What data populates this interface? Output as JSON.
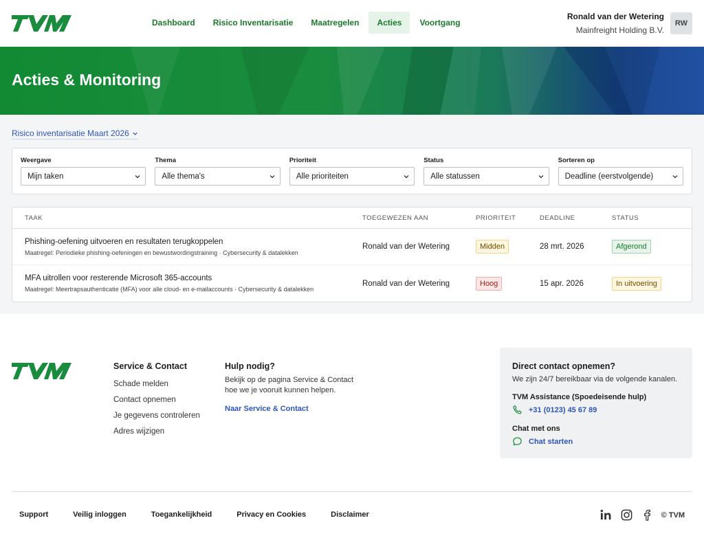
{
  "brand": {
    "logo_text": "TVM",
    "green": "#1a8c3e",
    "blue": "#1c4c9c"
  },
  "nav": {
    "items": [
      {
        "label": "Dashboard"
      },
      {
        "label": "Risico Inventarisatie"
      },
      {
        "label": "Maatregelen"
      },
      {
        "label": "Acties",
        "active": true
      },
      {
        "label": "Voortgang"
      }
    ]
  },
  "user": {
    "name": "Ronald van der Wetering",
    "company": "Mainfreight Holding B.V.",
    "initials": "RW"
  },
  "hero": {
    "title": "Acties & Monitoring"
  },
  "context": {
    "label": "Risico inventarisatie Maart 2026",
    "icon": "chevron-down-icon"
  },
  "filters": [
    {
      "label": "Weergave",
      "value": "Mijn taken"
    },
    {
      "label": "Thema",
      "value": "Alle thema's"
    },
    {
      "label": "Prioriteit",
      "value": "Alle prioriteiten"
    },
    {
      "label": "Status",
      "value": "Alle statussen"
    },
    {
      "label": "Sorteren op",
      "value": "Deadline (eerstvolgende)"
    }
  ],
  "table": {
    "columns": [
      "TAAK",
      "TOEGEWEZEN AAN",
      "PRIORITEIT",
      "DEADLINE",
      "STATUS"
    ],
    "rows": [
      {
        "title": "Phishing-oefening uitvoeren en resultaten terugkoppelen",
        "subtitle": "Maatregel: Periodieke phishing-oefeningen en bewustwordingstraining · Cybersecurity & datalekken",
        "assigned": "Ronald van der Wetering",
        "priority": "Midden",
        "deadline": "28 mrt. 2026",
        "status": "Afgerond"
      },
      {
        "title": "MFA uitrollen voor resterende Microsoft 365-accounts",
        "subtitle": "Maatregel: Meertrapsauthenticatie (MFA) voor alle cloud- en e-mailaccounts · Cybersecurity & datalekken",
        "assigned": "Ronald van der Wetering",
        "priority": "Hoog",
        "deadline": "15 apr. 2026",
        "status": "In uitvoering"
      }
    ]
  },
  "footer": {
    "service": {
      "heading": "Service & Contact",
      "links": [
        "Schade melden",
        "Contact opnemen",
        "Je gegevens controleren",
        "Adres wijzigen"
      ]
    },
    "help": {
      "heading": "Hulp nodig?",
      "text": "Bekijk op de pagina Service & Contact hoe we je vooruit kunnen helpen.",
      "cta": "Naar Service & Contact"
    },
    "contact": {
      "heading": "Direct contact opnemen?",
      "subtitle": "We zijn 24/7 bereikbaar via de volgende kanalen.",
      "assistance_label": "TVM Assistance (Spoedeisende hulp)",
      "phone": "+31 (0123) 45 67 89",
      "chat_label": "Chat met ons",
      "chat_cta": "Chat starten"
    },
    "bottom_links": [
      "Support",
      "Veilig inloggen",
      "Toegankelijkheid",
      "Privacy en Cookies",
      "Disclaimer"
    ],
    "social": [
      "linkedin-icon",
      "instagram-icon",
      "facebook-icon"
    ],
    "copyright": "© TVM"
  }
}
